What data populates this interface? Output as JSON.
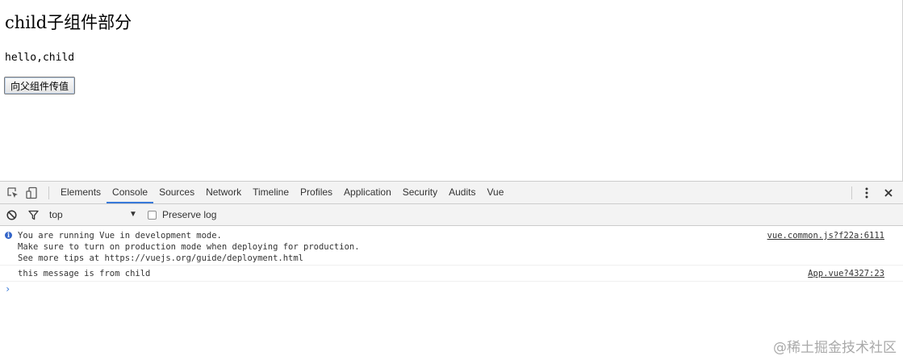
{
  "page": {
    "title": "child子组件部分",
    "text": "hello,child",
    "button_label": "向父组件传值"
  },
  "devtools": {
    "icons": [
      "inspect-element-icon",
      "device-toolbar-icon",
      "more-options-icon",
      "close-icon",
      "clear-console-icon",
      "filter-icon",
      "dropdown-arrow-icon",
      "info-icon",
      "prompt-chevron-icon"
    ],
    "tabs": [
      "Elements",
      "Console",
      "Sources",
      "Network",
      "Timeline",
      "Profiles",
      "Application",
      "Security",
      "Audits",
      "Vue"
    ],
    "active_tab": "Console",
    "accent_color": "#3879d9",
    "context": "top",
    "preserve_log_label": "Preserve log",
    "preserve_log_checked": false,
    "messages": [
      {
        "level": "info",
        "lines": [
          "You are running Vue in development mode.",
          "Make sure to turn on production mode when deploying for production.",
          "See more tips at https://vuejs.org/guide/deployment.html"
        ],
        "source": "vue.common.js?f22a:6111"
      },
      {
        "level": "log",
        "lines": [
          "this message is from child"
        ],
        "source": "App.vue?4327:23"
      }
    ]
  },
  "watermark": "@稀土掘金技术社区"
}
